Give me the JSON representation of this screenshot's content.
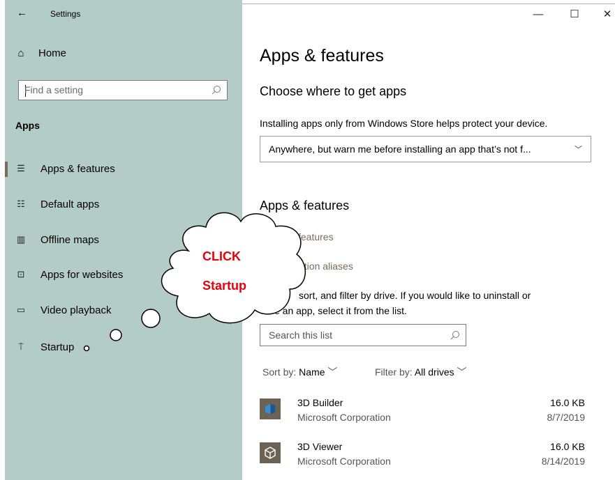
{
  "window": {
    "title": "Settings",
    "minimize_glyph": "—",
    "maximize_glyph": "☐",
    "close_glyph": "✕"
  },
  "sidebar": {
    "home_label": "Home",
    "search_placeholder": "Find a setting",
    "section_heading": "Apps",
    "items": [
      {
        "label": "Apps & features",
        "icon": "apps-features-icon",
        "active": true
      },
      {
        "label": "Default apps",
        "icon": "default-apps-icon"
      },
      {
        "label": "Offline maps",
        "icon": "offline-maps-icon"
      },
      {
        "label": "Apps for websites",
        "icon": "apps-for-websites-icon"
      },
      {
        "label": "Video playback",
        "icon": "video-playback-icon"
      },
      {
        "label": "Startup",
        "icon": "startup-icon"
      }
    ]
  },
  "main": {
    "title": "Apps & features",
    "choose_heading": "Choose where to get apps",
    "install_note": "Installing apps only from Windows Store helps protect your device.",
    "dropdown_value": "Anywhere, but warn me before installing an app that’s not f...",
    "apps_heading": "Apps & features",
    "optional_features_link": "l features",
    "execution_aliases_link": "ution aliases",
    "search_text_line1": "sort, and filter by drive. If you would like to uninstall or",
    "search_text_line2": "e an app, select it from the list.",
    "list_search_placeholder": "Search this list",
    "sort_label": "Sort by:",
    "sort_value": "Name",
    "filter_label": "Filter by:",
    "filter_value": "All drives",
    "apps": [
      {
        "name": "3D Builder",
        "publisher": "Microsoft Corporation",
        "size": "16.0 KB",
        "date": "8/7/2019"
      },
      {
        "name": "3D Viewer",
        "publisher": "Microsoft Corporation",
        "size": "16.0 KB",
        "date": "8/14/2019"
      }
    ]
  },
  "annotation": {
    "line1": "CLICK",
    "line2": "Startup",
    "color": "#e8000b"
  },
  "colors": {
    "sidebar_bg": "#b4ccc7",
    "accent": "#7a6a5a",
    "tile_bg": "#6b6253"
  }
}
